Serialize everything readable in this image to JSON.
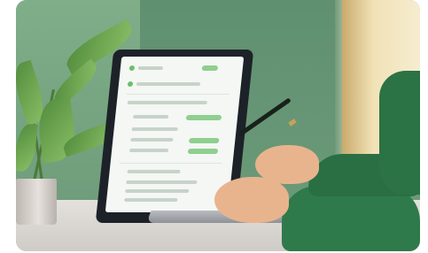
{
  "photo": {
    "subject": "laptop-form-photo",
    "accent_color": "#2f7a4a",
    "screen_accent_color": "#8fcf8f"
  }
}
